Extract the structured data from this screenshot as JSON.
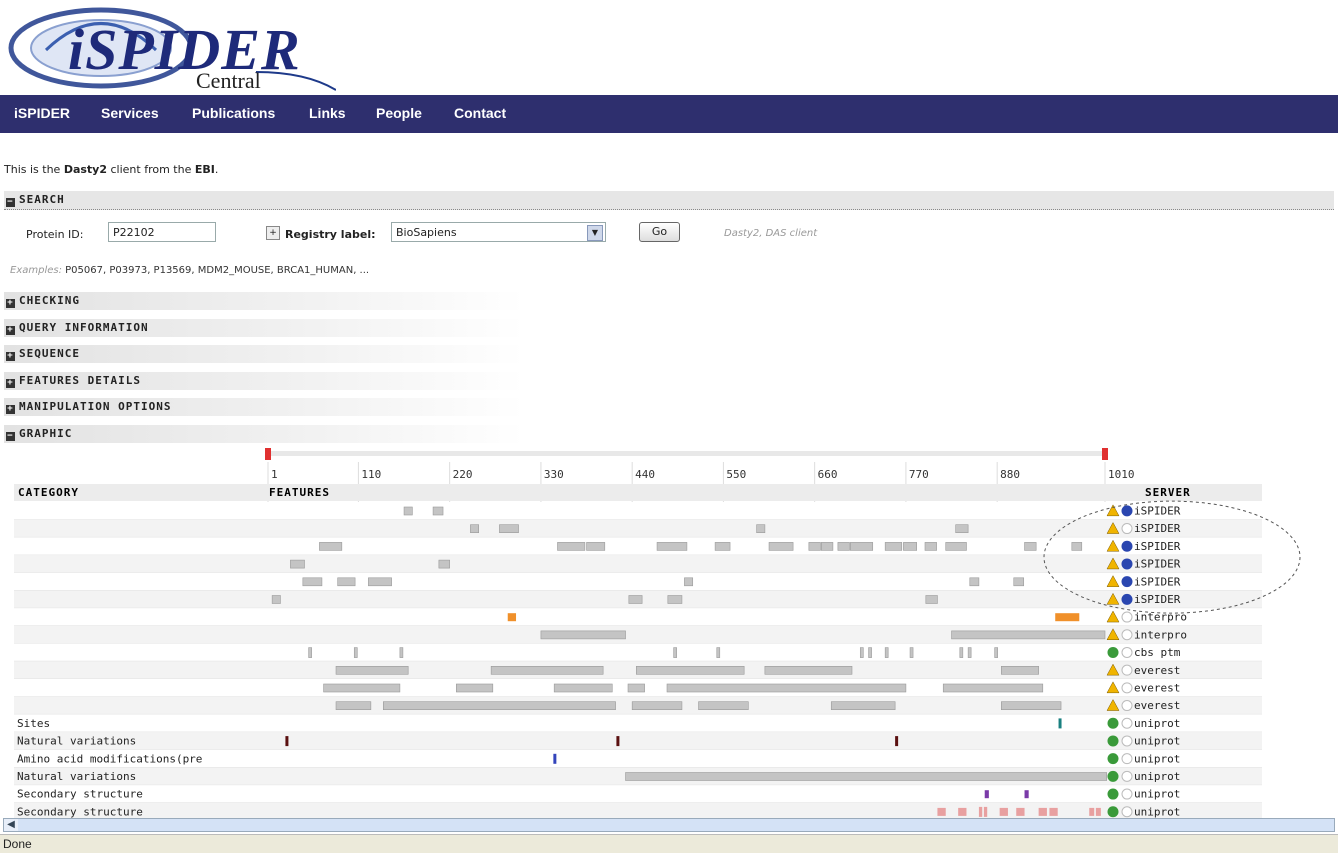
{
  "logo": {
    "title": "iSPIDER",
    "subtitle": "Central"
  },
  "nav": [
    "iSPIDER",
    "Services",
    "Publications",
    "Links",
    "People",
    "Contact"
  ],
  "intro": {
    "before": "This is the ",
    "client": "Dasty2",
    "middle": " client from the ",
    "org": "EBI",
    "after": "."
  },
  "sections": {
    "search": "SEARCH",
    "checking": "CHECKING",
    "query": "QUERY INFORMATION",
    "sequence": "SEQUENCE",
    "features": "FEATURES DETAILS",
    "manipulation": "MANIPULATION OPTIONS",
    "graphic": "GRAPHIC"
  },
  "search": {
    "protein_label": "Protein ID:",
    "protein_value": "P22102",
    "registry_label": "Registry label:",
    "registry_value": "BioSapiens",
    "go": "Go",
    "hint": "Dasty2, DAS client",
    "examples_label": "Examples:",
    "examples": "P05067, P03973, P13569, MDM2_MOUSE, BRCA1_HUMAN, ..."
  },
  "graphic": {
    "ruler_ticks": [
      "1",
      "110",
      "220",
      "330",
      "440",
      "550",
      "660",
      "770",
      "880",
      "1010"
    ],
    "ruler_values": [
      1,
      110,
      220,
      330,
      440,
      550,
      660,
      770,
      880,
      1010
    ],
    "col_category": "CATEGORY",
    "col_features": "FEATURES",
    "col_server": "SERVER",
    "colors": {
      "feature": "#c4c4c4",
      "interpro_orange": "#f0902a",
      "site_teal": "#1a8080",
      "variation_dark": "#5a1010",
      "modification_blue": "#3344bb",
      "secondary_purple": "#7a3aa8",
      "secondary_pink": "#e8a0a0",
      "warning": "#f0b400",
      "ok_green": "#3a9a3a",
      "info_blue": "#2a46b0"
    },
    "rows": [
      {
        "category": "",
        "server": "iSPIDER",
        "status": "warning",
        "info": "active",
        "features": [
          [
            165,
            175
          ],
          [
            200,
            212
          ]
        ]
      },
      {
        "category": "",
        "server": "iSPIDER",
        "status": "warning",
        "info": "inactive",
        "features": [
          [
            245,
            255
          ],
          [
            280,
            303
          ],
          [
            590,
            600
          ],
          [
            830,
            845
          ]
        ]
      },
      {
        "category": "",
        "server": "iSPIDER",
        "status": "warning",
        "info": "active",
        "features": [
          [
            63,
            90
          ],
          [
            350,
            383
          ],
          [
            385,
            407
          ],
          [
            470,
            506
          ],
          [
            540,
            558
          ],
          [
            605,
            634
          ],
          [
            653,
            667
          ],
          [
            668,
            682
          ],
          [
            688,
            702
          ],
          [
            703,
            730
          ],
          [
            745,
            765
          ],
          [
            767,
            783
          ],
          [
            793,
            807
          ],
          [
            818,
            843
          ],
          [
            913,
            927
          ],
          [
            970,
            982
          ]
        ]
      },
      {
        "category": "",
        "server": "iSPIDER",
        "status": "warning",
        "info": "active",
        "features": [
          [
            28,
            45
          ],
          [
            207,
            220
          ]
        ]
      },
      {
        "category": "",
        "server": "iSPIDER",
        "status": "warning",
        "info": "active",
        "features": [
          [
            43,
            66
          ],
          [
            85,
            106
          ],
          [
            122,
            150
          ],
          [
            503,
            513
          ],
          [
            847,
            858
          ],
          [
            900,
            912
          ]
        ]
      },
      {
        "category": "",
        "server": "iSPIDER",
        "status": "warning",
        "info": "active",
        "features": [
          [
            6,
            16
          ],
          [
            436,
            452
          ],
          [
            483,
            500
          ],
          [
            794,
            808
          ]
        ]
      },
      {
        "category": "",
        "server": "interpro",
        "status": "warning",
        "info": "inactive",
        "features": [
          [
            290,
            300,
            "interpro_orange"
          ],
          [
            950,
            979,
            "interpro_orange"
          ]
        ]
      },
      {
        "category": "",
        "server": "interpro",
        "status": "warning",
        "info": "inactive",
        "features": [
          [
            330,
            432
          ],
          [
            825,
            1010
          ]
        ]
      },
      {
        "category": "",
        "server": "cbs ptm",
        "status": "ok",
        "info": "inactive",
        "features": [
          [
            50,
            53
          ],
          [
            105,
            108
          ],
          [
            160,
            163
          ],
          [
            490,
            493
          ],
          [
            542,
            545
          ],
          [
            715,
            718
          ],
          [
            725,
            728
          ],
          [
            745,
            748
          ],
          [
            775,
            778
          ],
          [
            835,
            838
          ],
          [
            845,
            848
          ],
          [
            877,
            880
          ]
        ]
      },
      {
        "category": "",
        "server": "everest",
        "status": "warning",
        "info": "inactive",
        "features": [
          [
            83,
            170
          ],
          [
            270,
            405
          ],
          [
            445,
            575
          ],
          [
            600,
            705
          ],
          [
            885,
            930
          ]
        ]
      },
      {
        "category": "",
        "server": "everest",
        "status": "warning",
        "info": "inactive",
        "features": [
          [
            68,
            160
          ],
          [
            228,
            272
          ],
          [
            346,
            416
          ],
          [
            435,
            455
          ],
          [
            482,
            770
          ],
          [
            815,
            935
          ]
        ]
      },
      {
        "category": "",
        "server": "everest",
        "status": "warning",
        "info": "inactive",
        "features": [
          [
            83,
            125
          ],
          [
            140,
            420
          ],
          [
            440,
            500
          ],
          [
            520,
            580
          ],
          [
            680,
            757
          ],
          [
            885,
            957
          ]
        ]
      },
      {
        "category": "Sites",
        "server": "uniprot",
        "status": "ok",
        "info": "inactive",
        "features": [
          [
            954,
            957,
            "site_teal"
          ]
        ]
      },
      {
        "category": "Natural variations",
        "server": "uniprot",
        "status": "ok",
        "info": "inactive",
        "features": [
          [
            22,
            25,
            "variation_dark"
          ],
          [
            421,
            424,
            "variation_dark"
          ],
          [
            757,
            760,
            "variation_dark"
          ]
        ]
      },
      {
        "category": "Amino acid modifications(pre",
        "server": "uniprot",
        "status": "ok",
        "info": "inactive",
        "features": [
          [
            345,
            348,
            "modification_blue"
          ]
        ]
      },
      {
        "category": "Natural variations",
        "server": "uniprot",
        "status": "ok",
        "info": "inactive",
        "features": [
          [
            432,
            1012
          ]
        ]
      },
      {
        "category": "Secondary structure",
        "server": "uniprot",
        "status": "ok",
        "info": "inactive",
        "features": [
          [
            865,
            870,
            "secondary_purple"
          ],
          [
            913,
            918,
            "secondary_purple"
          ]
        ]
      },
      {
        "category": "Secondary structure",
        "server": "uniprot",
        "status": "ok",
        "info": "inactive",
        "features": [
          [
            808,
            818,
            "secondary_pink"
          ],
          [
            833,
            843,
            "secondary_pink"
          ],
          [
            858,
            862,
            "secondary_pink"
          ],
          [
            864,
            868,
            "secondary_pink"
          ],
          [
            883,
            893,
            "secondary_pink"
          ],
          [
            903,
            913,
            "secondary_pink"
          ],
          [
            930,
            940,
            "secondary_pink"
          ],
          [
            943,
            953,
            "secondary_pink"
          ],
          [
            991,
            997,
            "secondary_pink"
          ],
          [
            999,
            1005,
            "secondary_pink"
          ]
        ]
      }
    ]
  },
  "status_bar": "Done"
}
